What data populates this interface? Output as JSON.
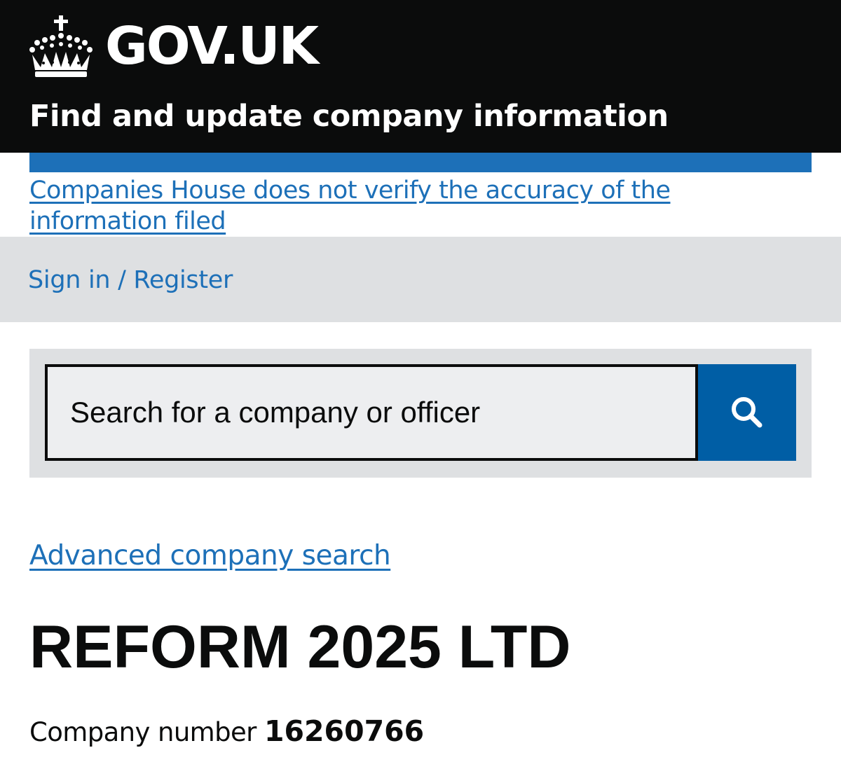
{
  "header": {
    "logo_text": "GOV.UK",
    "service_name": "Find and update company information",
    "background_color": "#0b0c0c"
  },
  "notice": {
    "link_text": "Companies House does not verify the accuracy of the information filed",
    "bar_color": "#1d70b8"
  },
  "account": {
    "signin_label": "Sign in / Register"
  },
  "search": {
    "placeholder": "Search for a company or officer",
    "value": "",
    "button_icon": "search-icon",
    "button_color": "#005ea5"
  },
  "main": {
    "advanced_search_label": "Advanced company search",
    "company_name": "REFORM 2025 LTD",
    "company_number_label": "Company number",
    "company_number": "16260766"
  },
  "colors": {
    "link": "#1d70b8",
    "panel_background": "#dee0e2",
    "text": "#0b0c0c"
  }
}
